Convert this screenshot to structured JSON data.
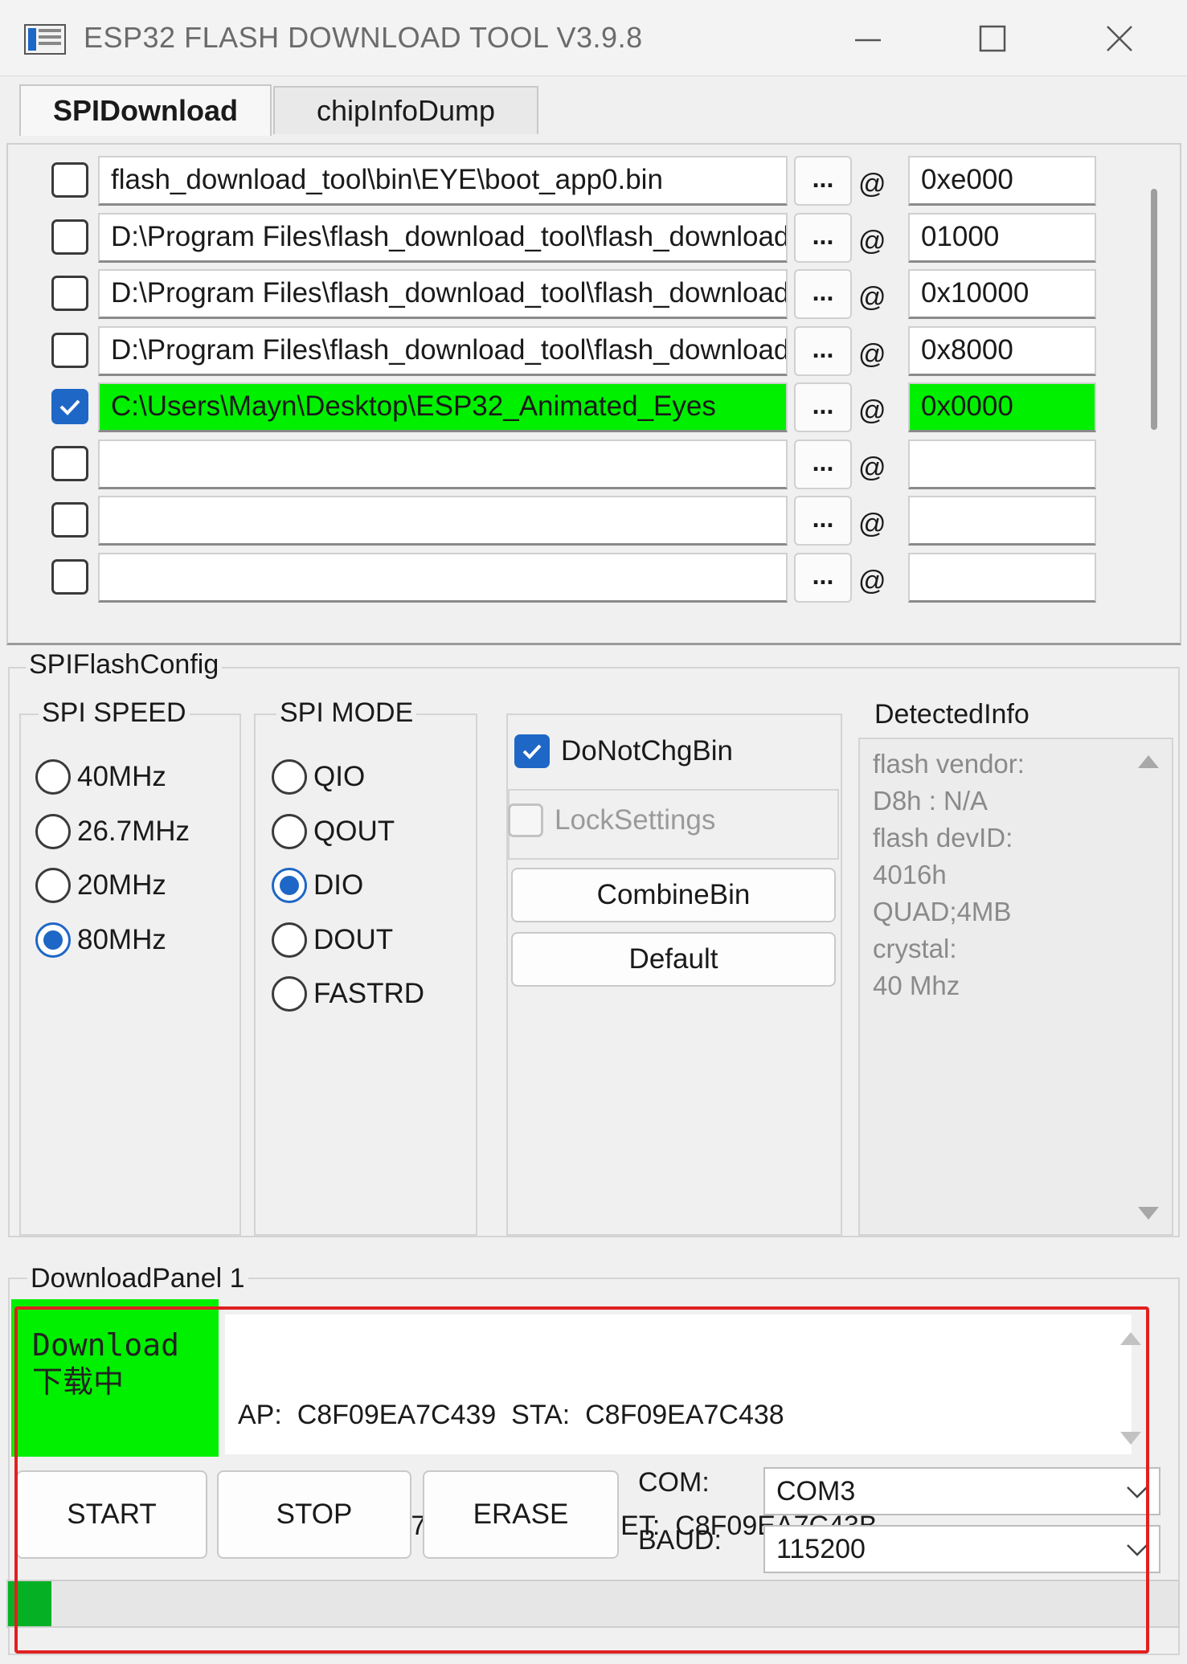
{
  "window": {
    "title": "ESP32 FLASH DOWNLOAD TOOL V3.9.8"
  },
  "tabs": [
    {
      "label": "SPIDownload"
    },
    {
      "label": "chipInfoDump"
    }
  ],
  "file_rows": [
    {
      "checked": false,
      "path": "flash_download_tool\\bin\\EYE\\boot_app0.bin",
      "browse": "...",
      "at": "@",
      "address": "0xe000",
      "highlight": false
    },
    {
      "checked": false,
      "path": "D:\\Program Files\\flash_download_tool\\flash_download_tool",
      "browse": "...",
      "at": "@",
      "address": "01000",
      "highlight": false
    },
    {
      "checked": false,
      "path": "D:\\Program Files\\flash_download_tool\\flash_download_tool",
      "browse": "...",
      "at": "@",
      "address": "0x10000",
      "highlight": false
    },
    {
      "checked": false,
      "path": "D:\\Program Files\\flash_download_tool\\flash_download_tool",
      "browse": "...",
      "at": "@",
      "address": "0x8000",
      "highlight": false
    },
    {
      "checked": true,
      "path": "C:\\Users\\Mayn\\Desktop\\ESP32_Animated_Eyes",
      "browse": "...",
      "at": "@",
      "address": "0x0000",
      "highlight": true
    },
    {
      "checked": false,
      "path": "",
      "browse": "...",
      "at": "@",
      "address": "",
      "highlight": false
    },
    {
      "checked": false,
      "path": "",
      "browse": "...",
      "at": "@",
      "address": "",
      "highlight": false
    },
    {
      "checked": false,
      "path": "",
      "browse": "...",
      "at": "@",
      "address": "",
      "highlight": false
    }
  ],
  "spi_flash_config": {
    "title": "SPIFlashConfig",
    "speed": {
      "title": "SPI SPEED",
      "options": [
        "40MHz",
        "26.7MHz",
        "20MHz",
        "80MHz"
      ],
      "selected": "80MHz"
    },
    "mode": {
      "title": "SPI MODE",
      "options": [
        "QIO",
        "QOUT",
        "DIO",
        "DOUT",
        "FASTRD"
      ],
      "selected": "DIO"
    },
    "do_not_chg_bin": {
      "label": "DoNotChgBin",
      "checked": true
    },
    "lock_settings": {
      "label": "LockSettings",
      "checked": false
    },
    "combine_bin": "CombineBin",
    "default": "Default",
    "detected_info": {
      "title": "DetectedInfo",
      "lines": [
        "flash vendor:",
        "D8h : N/A",
        "flash devID:",
        "4016h",
        "QUAD;4MB",
        "crystal:",
        "40 Mhz"
      ]
    }
  },
  "download_panel": {
    "title": "DownloadPanel 1",
    "status_line1": "Download",
    "status_line2": "下载中",
    "mac_line1": "AP:  C8F09EA7C439  STA:  C8F09EA7C438",
    "mac_line2": "BT:  C8F09EA7C43A  ETHERNET:  C8F09EA7C43B",
    "buttons": {
      "start": "START",
      "stop": "STOP",
      "erase": "ERASE"
    },
    "com_label": "COM:",
    "com_value": "COM3",
    "baud_label": "BAUD:",
    "baud_value": "115200",
    "progress": 0.037
  },
  "colors": {
    "accent": "#1e67c6",
    "status_green": "#00f000",
    "progress_green": "#06b025",
    "annotation_red": "#e02020"
  }
}
